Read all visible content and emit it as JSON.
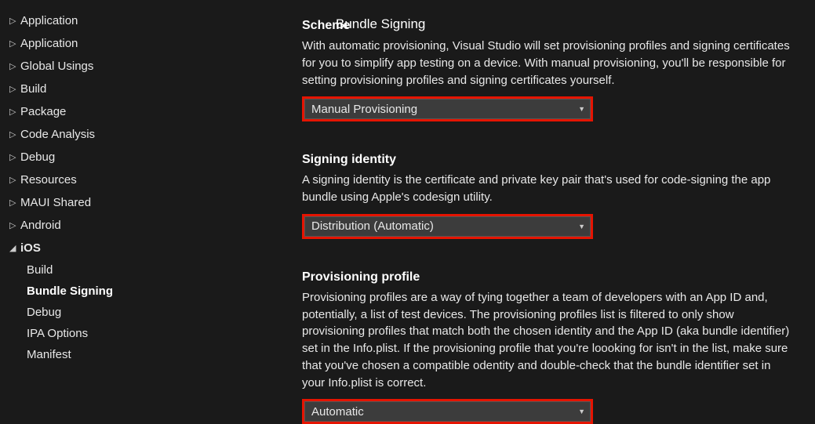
{
  "sectionTitle": "Bundle Signing",
  "sidebar": {
    "items": [
      {
        "label": "Application",
        "expanded": false
      },
      {
        "label": "Application",
        "expanded": false
      },
      {
        "label": "Global Usings",
        "expanded": false
      },
      {
        "label": "Build",
        "expanded": false
      },
      {
        "label": "Package",
        "expanded": false
      },
      {
        "label": "Code Analysis",
        "expanded": false
      },
      {
        "label": "Debug",
        "expanded": false
      },
      {
        "label": "Resources",
        "expanded": false
      },
      {
        "label": "MAUI Shared",
        "expanded": false
      },
      {
        "label": "Android",
        "expanded": false
      }
    ],
    "iosLabel": "iOS",
    "iosChildren": [
      {
        "label": "Build",
        "active": false
      },
      {
        "label": "Bundle Signing",
        "active": true
      },
      {
        "label": "Debug",
        "active": false
      },
      {
        "label": "IPA Options",
        "active": false
      },
      {
        "label": "Manifest",
        "active": false
      }
    ]
  },
  "fields": {
    "scheme": {
      "label": "Scheme",
      "desc": "With automatic provisioning, Visual Studio will set provisioning profiles and signing certificates for you to simplify app testing on a device. With manual provisioning, you'll be responsible for setting provisioning profiles and signing certificates yourself.",
      "value": "Manual Provisioning"
    },
    "signingIdentity": {
      "label": "Signing identity",
      "desc": "A signing identity is the certificate and private key pair that's used for code-signing the app bundle using Apple's codesign utility.",
      "value": "Distribution (Automatic)"
    },
    "provisioningProfile": {
      "label": "Provisioning profile",
      "desc": "Provisioning profiles are a way of tying together a team of developers with an App ID and, potentially, a list of test devices. The provisioning profiles list is filtered to only show provisioning profiles that match both the chosen identity and the App ID (aka bundle identifier) set in the Info.plist. If the provisioning profile that you're loooking for isn't in the list, make sure that you've chosen a compatible odentity and double-check that the bundle identifier set in your Info.plist is correct.",
      "value": "Automatic"
    }
  }
}
